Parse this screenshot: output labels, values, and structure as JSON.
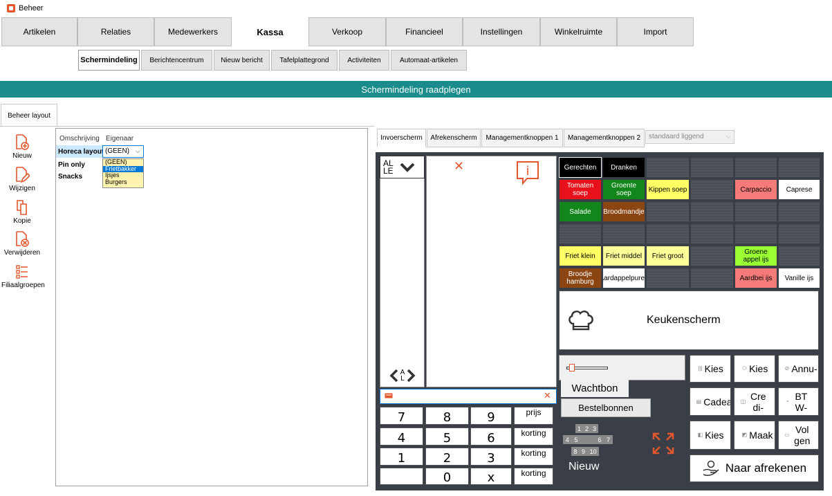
{
  "app": {
    "title": "Beheer"
  },
  "main_tabs": [
    "Artikelen",
    "Relaties",
    "Medewerkers",
    "Kassa",
    "Verkoop",
    "Financieel",
    "Instellingen",
    "Winkelruimte",
    "Import"
  ],
  "active_main_tab": "Kassa",
  "sub_tabs": [
    "Schermindeling",
    "Berichtencentrum",
    "Nieuw bericht",
    "Tafelplattegrond",
    "Activiteiten",
    "Automaat-artikelen"
  ],
  "banner": "Schermindeling raadplegen",
  "left_tab": "Beheer layout",
  "side_buttons": [
    "Nieuw",
    "Wijzigen",
    "Kopie",
    "Verwijderen",
    "Filiaalgroepen"
  ],
  "grid": {
    "columns": [
      "Omschrijving",
      "Eigenaar"
    ],
    "rows": [
      "Horeca layout",
      "Pin only",
      "Snacks"
    ],
    "editor_value": "(GEEN)",
    "dropdown_options": [
      "(GEEN)",
      "Frietbakker",
      "Ijsjes",
      "Burgers"
    ],
    "dropdown_selected": "Frietbakker"
  },
  "right_tabs": [
    "Invoerscherm",
    "Afrekenscherm",
    "Managementknoppen 1",
    "Managementknoppen 2"
  ],
  "orientation": {
    "value": "standaard liggend"
  },
  "pos": {
    "group_label": "ALLE",
    "scroll_label": "AL",
    "numpad": [
      "7",
      "8",
      "9",
      "4",
      "5",
      "6",
      "1",
      "2",
      "3",
      "",
      "0",
      "x"
    ],
    "price_keys": [
      "prijs",
      "korting",
      "korting",
      "korting"
    ],
    "products": [
      {
        "label": "Gerechten",
        "bg": "#000000",
        "fg": "#ffffff"
      },
      {
        "label": "Dranken",
        "bg": "#000000",
        "fg": "#ffffff"
      },
      {
        "label": "Tomaten soep",
        "bg": "#e8101a",
        "fg": "#ffffff"
      },
      {
        "label": "Groente soep",
        "bg": "#12861a",
        "fg": "#ffffff"
      },
      {
        "label": "Kippen soep",
        "bg": "#ffff66",
        "fg": "#000000"
      },
      {
        "label": "Carpaccio",
        "bg": "#f57b7b",
        "fg": "#000000"
      },
      {
        "label": "Caprese",
        "bg": "#ffffff",
        "fg": "#000000"
      },
      {
        "label": "Salade",
        "bg": "#12861a",
        "fg": "#ffffff"
      },
      {
        "label": "Broodmandje",
        "bg": "#8b4513",
        "fg": "#ffffff"
      },
      {
        "label": "Friet klein",
        "bg": "#ffff66",
        "fg": "#000000"
      },
      {
        "label": "Friet middel",
        "bg": "#ffff99",
        "fg": "#000000"
      },
      {
        "label": "Friet groot",
        "bg": "#ffff99",
        "fg": "#000000"
      },
      {
        "label": "Groene appel ijs",
        "bg": "#99ff33",
        "fg": "#000000"
      },
      {
        "label": "Broodje hamburg",
        "bg": "#8b4513",
        "fg": "#ffffff"
      },
      {
        "label": "Aardappelpuree",
        "bg": "#ffffff",
        "fg": "#000000"
      },
      {
        "label": "Aardbei ijs",
        "bg": "#f57b7b",
        "fg": "#000000"
      },
      {
        "label": "Vanille ijs",
        "bg": "#ffffff",
        "fg": "#000000"
      }
    ],
    "kitchen": "Keukenscherm",
    "wachtbon": "Wachtbon",
    "bestelbonnen": "Bestelbonnen",
    "table_numbers": [
      "1",
      "2",
      "3",
      "4",
      "5",
      "6",
      "7",
      "8",
      "9",
      "10"
    ],
    "nieuw": "Nieuw",
    "actions": [
      "Kies",
      "Kies",
      "Annu-",
      "Cadeau",
      "Cre di-",
      "BT W-",
      "Kies",
      "Maak",
      "Vol gen"
    ],
    "checkout": "Naar afrekenen"
  },
  "colors": {
    "accent": "#e4572e",
    "banner": "#1a8c8c",
    "pos_bg": "#3a3f47"
  }
}
